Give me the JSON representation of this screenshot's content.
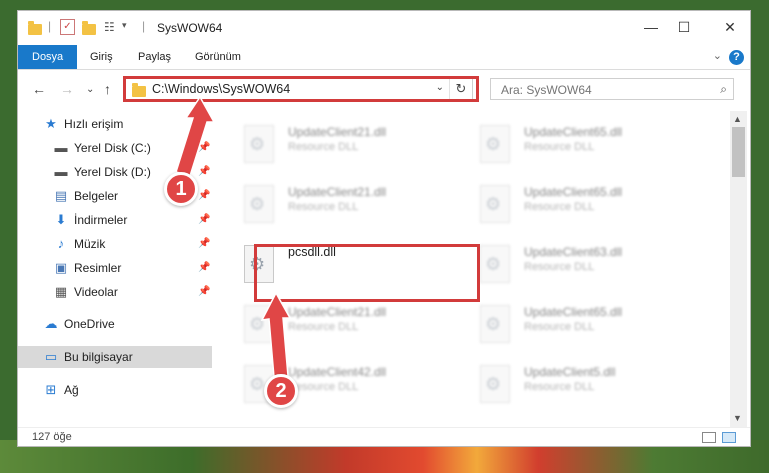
{
  "window": {
    "title": "SysWOW64",
    "controls": {
      "minimize": "—",
      "maximize": "☐",
      "close": "✕"
    }
  },
  "ribbon": {
    "tabs": [
      "Dosya",
      "Giriş",
      "Paylaş",
      "Görünüm"
    ],
    "help": "?",
    "expand": "⌄"
  },
  "nav": {
    "back": "←",
    "forward": "→",
    "recent": "⌄",
    "up": "↑",
    "address": "C:\\Windows\\SysWOW64",
    "address_chevron": "⌄",
    "refresh": "↻",
    "search_placeholder": "Ara: SysWOW64",
    "search_icon": "⌕"
  },
  "sidebar": {
    "items": [
      {
        "label": "Hızlı erişim",
        "icon": "star-icon",
        "glyph": "★",
        "color": "#2a7bd1"
      },
      {
        "label": "Yerel Disk (C:)",
        "icon": "disk-icon",
        "glyph": "▬",
        "color": "#555555",
        "pin": "📌"
      },
      {
        "label": "Yerel Disk (D:)",
        "icon": "disk-icon",
        "glyph": "▬",
        "color": "#555555",
        "pin": "📌"
      },
      {
        "label": "Belgeler",
        "icon": "documents-icon",
        "glyph": "▤",
        "color": "#4a78b5",
        "pin": "📌"
      },
      {
        "label": "İndirmeler",
        "icon": "download-icon",
        "glyph": "⬇",
        "color": "#2a7bd1",
        "pin": "📌"
      },
      {
        "label": "Müzik",
        "icon": "music-icon",
        "glyph": "♪",
        "color": "#2a7bd1",
        "pin": "📌"
      },
      {
        "label": "Resimler",
        "icon": "pictures-icon",
        "glyph": "▣",
        "color": "#4a78b5",
        "pin": "📌"
      },
      {
        "label": "Videolar",
        "icon": "videos-icon",
        "glyph": "▦",
        "color": "#555555",
        "pin": "📌"
      },
      {
        "label": "OneDrive",
        "icon": "cloud-icon",
        "glyph": "☁",
        "color": "#2a7bd1"
      },
      {
        "label": "Bu bilgisayar",
        "icon": "computer-icon",
        "glyph": "▭",
        "color": "#2a7bd1"
      },
      {
        "label": "Ağ",
        "icon": "network-icon",
        "glyph": "⊞",
        "color": "#2a7bd1"
      }
    ]
  },
  "files": [
    {
      "name": "UpdateClient21.dll",
      "type": "Resource DLL"
    },
    {
      "name": "UpdateClient65.dll",
      "type": "Resource DLL"
    },
    {
      "name": "UpdateClient21.dll",
      "type": "Resource DLL"
    },
    {
      "name": "UpdateClient65.dll",
      "type": "Resource DLL"
    },
    {
      "name": "pcsdll.dll",
      "type": ""
    },
    {
      "name": "UpdateClient63.dll",
      "type": "Resource DLL"
    },
    {
      "name": "UpdateClient21.dll",
      "type": "Resource DLL"
    },
    {
      "name": "UpdateClient65.dll",
      "type": "Resource DLL"
    },
    {
      "name": "UpdateClient42.dll",
      "type": "Resource DLL"
    },
    {
      "name": "UpdateClient5.dll",
      "type": "Resource DLL"
    }
  ],
  "status": {
    "count": "127 öğe"
  },
  "annotations": {
    "step1": "1",
    "step2": "2",
    "color": "#e04646"
  }
}
